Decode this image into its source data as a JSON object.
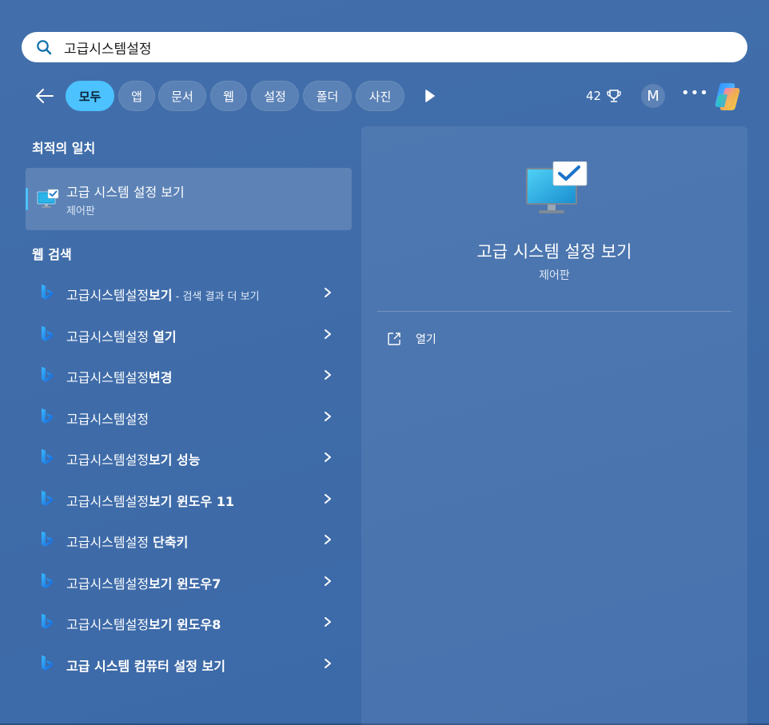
{
  "search": {
    "value": "고급시스템설정",
    "placeholder": ""
  },
  "tabs": [
    {
      "label": "모두",
      "active": true
    },
    {
      "label": "앱"
    },
    {
      "label": "문서"
    },
    {
      "label": "웹"
    },
    {
      "label": "설정"
    },
    {
      "label": "폴더"
    },
    {
      "label": "사진"
    }
  ],
  "toolbar": {
    "points": "42",
    "avatar": "M",
    "more": "•••"
  },
  "best_match": {
    "heading": "최적의 일치",
    "name": "고급 시스템 설정 보기",
    "sub": "제어판"
  },
  "web": {
    "heading": "웹 검색",
    "items": [
      {
        "plain": "고급시스템설정",
        "bold": "보기",
        "suffix": " - 검색 결과 더 보기"
      },
      {
        "plain": "고급시스템설정 ",
        "bold": "열기",
        "suffix": ""
      },
      {
        "plain": "고급시스템설정",
        "bold": "변경",
        "suffix": ""
      },
      {
        "plain": "고급시스템설정",
        "bold": "",
        "suffix": ""
      },
      {
        "plain": "고급시스템설정",
        "bold": "보기 성능",
        "suffix": ""
      },
      {
        "plain": "고급시스템설정",
        "bold": "보기 윈도우 11",
        "suffix": ""
      },
      {
        "plain": "고급시스템설정 ",
        "bold": "단축키",
        "suffix": ""
      },
      {
        "plain": "고급시스템설정",
        "bold": "보기 윈도우7",
        "suffix": ""
      },
      {
        "plain": "고급시스템설정",
        "bold": "보기 윈도우8",
        "suffix": ""
      },
      {
        "plain": "",
        "bold": "고급 시스템 컴퓨터 설정 보기",
        "suffix": ""
      }
    ]
  },
  "details": {
    "title": "고급 시스템 설정 보기",
    "sub": "제어판",
    "action_label": "열기"
  },
  "colors": {
    "accent": "#4cc2ff",
    "background": "#3f6ca9"
  }
}
